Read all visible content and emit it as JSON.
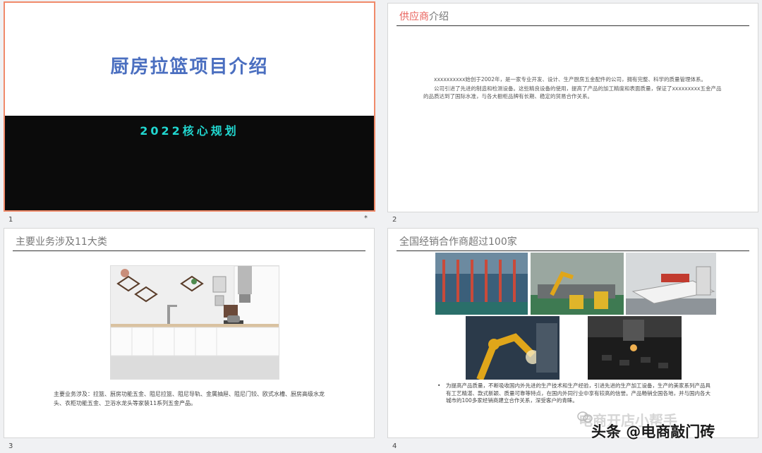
{
  "slides": [
    {
      "number": "1",
      "title": "厨房拉篮项目介绍",
      "subtitle": "2022核心规划",
      "marker": "*"
    },
    {
      "number": "2",
      "heading_accent": "供应商",
      "heading_rest": "介绍",
      "paragraphs": [
        "xxxxxxxxxx始创于2002年，是一家专业开发、设计、生产厨房五金配件的公司，拥有完整、科学的质量管理体系。",
        "公司引进了先进的制造和检测设备。这些精良设备的使用，提高了产品的加工精度和表面质量，保证了xxxxxxxxx五金产品的品质达到了国际水准，与各大橱柜品牌有长期、稳定的贸易合作关系。"
      ]
    },
    {
      "number": "3",
      "heading": "主要业务涉及11大类",
      "caption": "主要业务涉及：拉篮、厨房功能五金、阻尼拉篮、阻尼导轨、金属抽屉、阻尼门铰、欧式水槽、厨房高级水龙头、衣柜功能五金、卫浴水龙头等家装11系列五金产品。"
    },
    {
      "number": "4",
      "heading": "全国经销合作商超过100家",
      "bullet": "为提高产品质量，不断吸收国内外先进的生产技术和生产经验，引进先进的生产加工设备，生产的美家系列产品具有工艺精湛、款式新颖、质量可靠等特点，在国内外同行业中享有较高的信誉。产品畅销全国各地，并与国内各大城市的100多家经销商建立合作关系，深受客户的青睐。"
    }
  ],
  "watermark": {
    "line1": "电商开店小帮手",
    "line2": "头条 @电商敲门砖"
  },
  "colors": {
    "title_blue": "#4b6fc0",
    "subtitle_cyan": "#21d7d0",
    "accent_red": "#e8605a",
    "selected_border": "#f08a6a"
  }
}
